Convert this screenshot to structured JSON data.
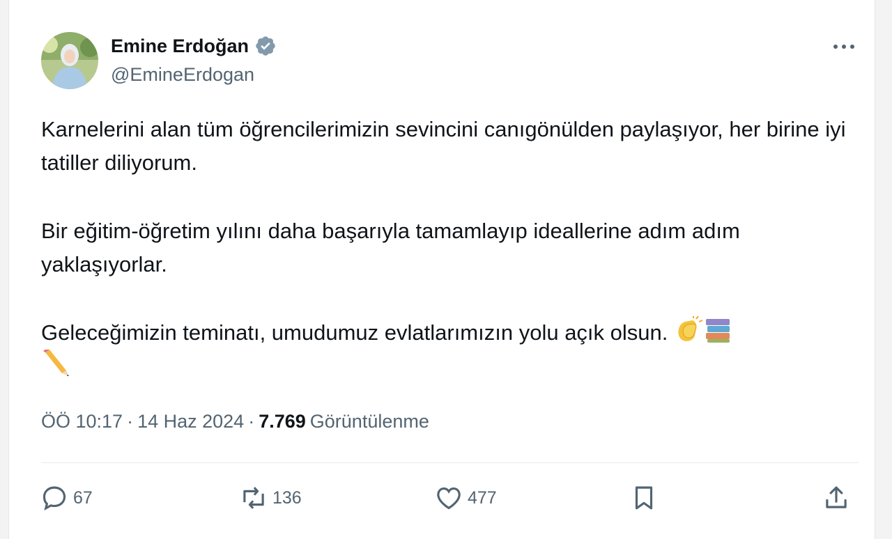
{
  "author": {
    "name": "Emine Erdoğan",
    "handle": "@EmineErdogan"
  },
  "tweet": {
    "paragraphs": [
      "Karnelerini alan tüm öğrencilerimizin sevincini canıgönülden paylaşıyor, her birine iyi tatiller diliyorum.",
      "Bir eğitim-öğretim yılını daha başarıyla tamamlayıp ideallerine adım adım yaklaşıyorlar.",
      "Geleceğimizin teminatı, umudumuz evlatlarımızın yolu açık olsun."
    ],
    "emojis": [
      "clapping-hands",
      "books",
      "pencil"
    ]
  },
  "meta": {
    "time": "ÖÖ 10:17",
    "date": "14 Haz 2024",
    "separator": "·",
    "views_count": "7.769",
    "views_label": "Görüntülenme"
  },
  "actions": {
    "reply_count": "67",
    "retweet_count": "136",
    "like_count": "477"
  },
  "colors": {
    "text": "#0f1419",
    "secondary": "#536471",
    "verified_badge": "#829aab",
    "divider": "#e6ecf0"
  }
}
